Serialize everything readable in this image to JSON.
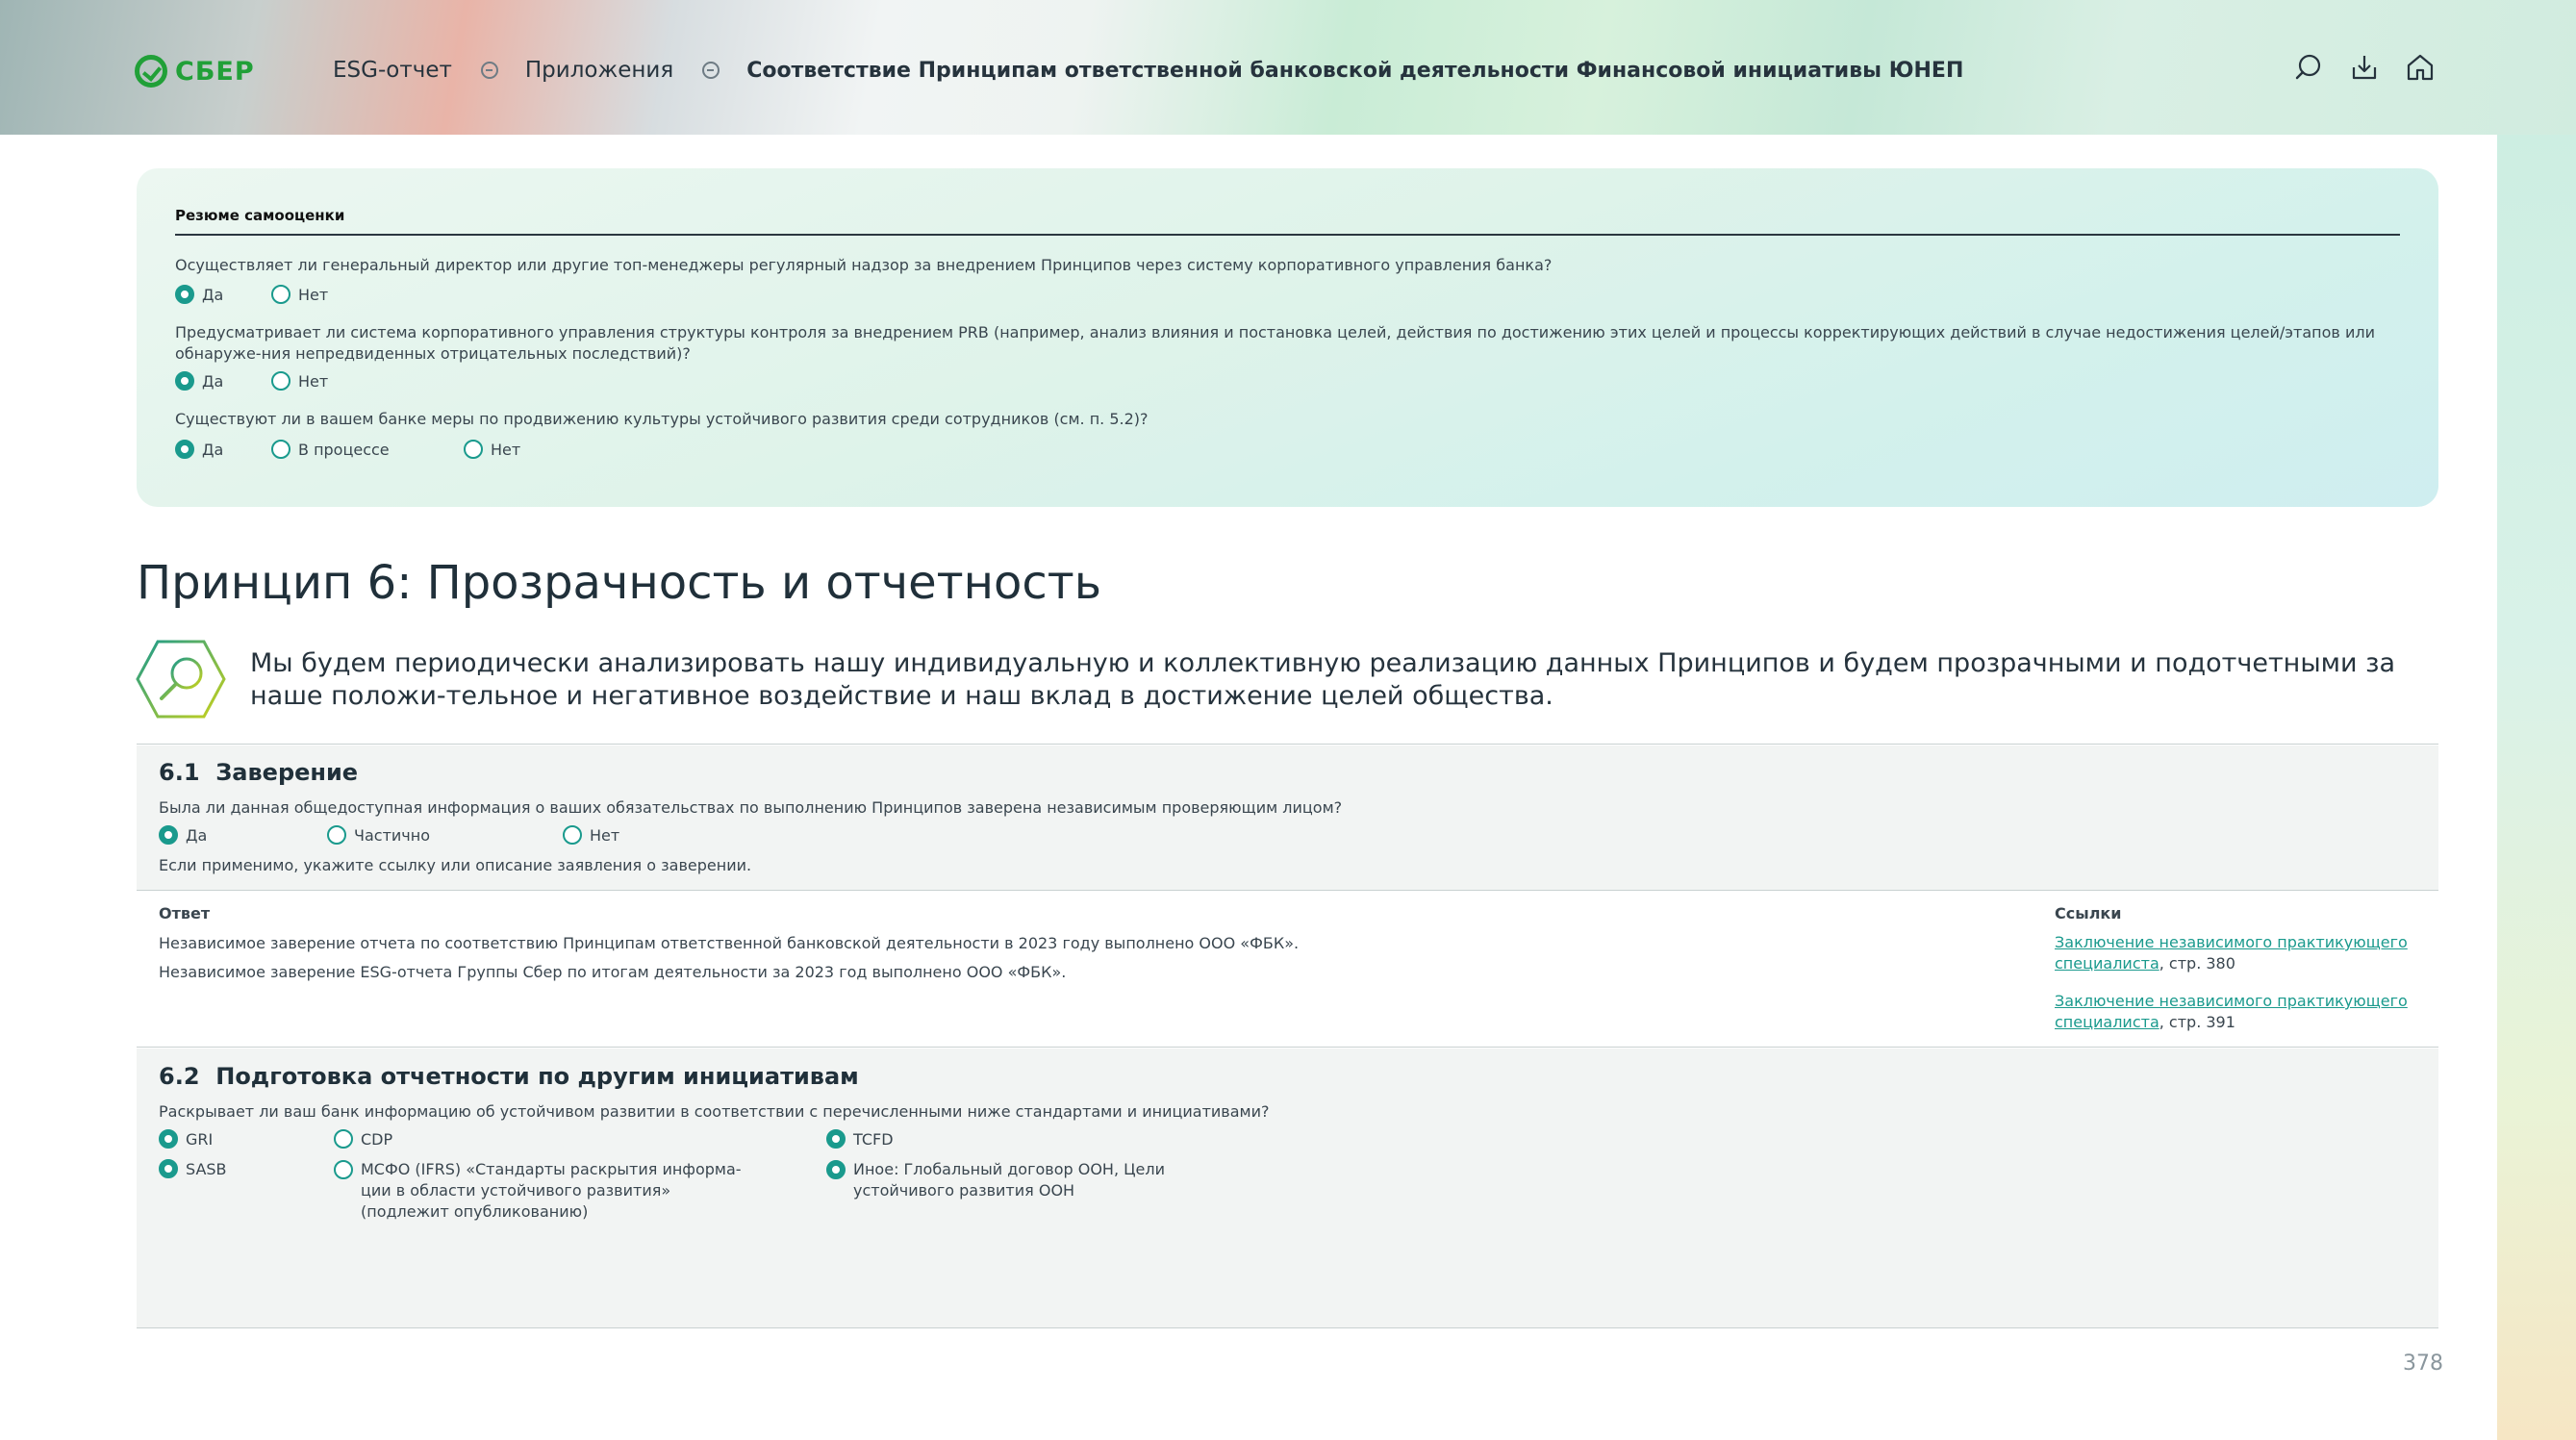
{
  "header": {
    "brand": "СБЕР",
    "breadcrumbs": [
      "ESG-отчет",
      "Приложения",
      "Соответствие Принципам ответственной банковской деятельности Финансовой инициативы ЮНЕП"
    ],
    "icons": [
      "search-icon",
      "download-icon",
      "home-icon"
    ]
  },
  "summary": {
    "title": "Резюме самооценки",
    "questions": [
      {
        "text": "Осуществляет ли генеральный директор или другие топ-менеджеры регулярный надзор за внедрением Принципов через систему корпоративного управления банка?",
        "options": [
          {
            "label": "Да",
            "selected": true
          },
          {
            "label": "Нет",
            "selected": false
          }
        ]
      },
      {
        "text": "Предусматривает ли система корпоративного управления структуры контроля за внедрением PRB (например, анализ влияния и постановка целей, действия по достижению этих целей и процессы корректирующих действий в случае недостижения целей/этапов или обнаруже-ния непредвиденных отрицательных последствий)?",
        "options": [
          {
            "label": "Да",
            "selected": true
          },
          {
            "label": "Нет",
            "selected": false
          }
        ]
      },
      {
        "text": "Существуют ли в вашем банке меры по продвижению культуры устойчивого развития среди сотрудников (см. п. 5.2)?",
        "options": [
          {
            "label": "Да",
            "selected": true
          },
          {
            "label": "В процессе",
            "selected": false
          },
          {
            "label": "Нет",
            "selected": false
          }
        ]
      }
    ]
  },
  "principle": {
    "title": "Принцип 6: Прозрачность и отчетность",
    "text": "Мы будем периодически анализировать нашу индивидуальную и коллективную реализацию данных Принципов и будем прозрачными и подотчетными за наше положи-тельное и негативное воздействие и наш вклад в достижение целей общества."
  },
  "section61": {
    "num": "6.1",
    "title": "Заверение",
    "question": "Была ли данная общедоступная информация о ваших обязательствах по выполнению Принципов заверена независимым проверяющим лицом?",
    "options": [
      {
        "label": "Да",
        "selected": true
      },
      {
        "label": "Частично",
        "selected": false
      },
      {
        "label": "Нет",
        "selected": false
      }
    ],
    "note": "Если применимо, укажите ссылку или описание заявления о заверении.",
    "answer_label": "Ответ",
    "answers": [
      "Независимое заверение отчета по соответствию Принципам ответственной банковской деятельности в 2023 году выполнено ООО «ФБК».",
      "Независимое заверение ESG-отчета Группы Сбер по итогам деятельности за 2023 год выполнено ООО «ФБК»."
    ],
    "links_label": "Ссылки",
    "links": [
      {
        "text": "Заключение независимого практикующего специалиста",
        "suffix": ", стр. 380"
      },
      {
        "text": "Заключение независимого практикующего специалиста",
        "suffix": ", стр. 391"
      }
    ]
  },
  "section62": {
    "num": "6.2",
    "title": "Подготовка отчетности по другим инициативам",
    "question": "Раскрывает ли ваш банк информацию об устойчивом развитии в соответствии с перечисленными ниже стандартами и инициативами?",
    "options": [
      {
        "label": "GRI",
        "selected": true
      },
      {
        "label": "SASB",
        "selected": true
      },
      {
        "label": "CDP",
        "selected": false
      },
      {
        "label": "МСФО (IFRS) «Стандарты раскрытия информа-ции в области устойчивого развития» (подлежит опубликованию)",
        "selected": false
      },
      {
        "label": "TCFD",
        "selected": true
      },
      {
        "label": "Иное: Глобальный договор ООН, Цели устойчивого развития ООН",
        "selected": true
      }
    ]
  },
  "footer": {
    "page": "378"
  },
  "colors": {
    "accent": "#1a9a8d",
    "brand": "#21a038"
  }
}
